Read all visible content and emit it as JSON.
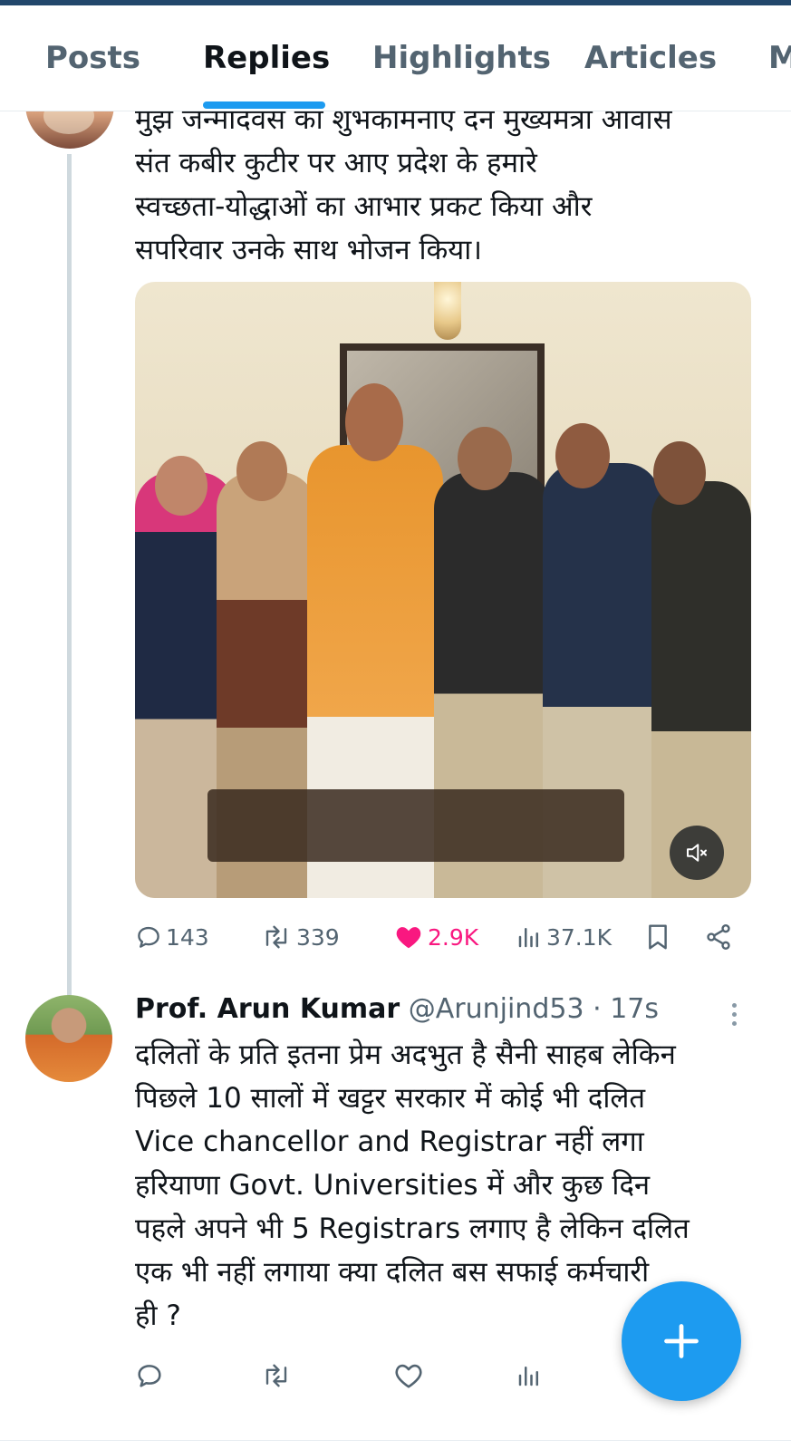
{
  "tabs": [
    {
      "label": "Posts"
    },
    {
      "label": "Replies"
    },
    {
      "label": "Highlights"
    },
    {
      "label": "Articles"
    }
  ],
  "active_tab": "Replies",
  "tweet": {
    "text_lines": [
      "मुझे जन्मदिवस की शुभकामनाएं देने मुख्यमंत्री आवास",
      "संत कबीर कुटीर पर आए प्रदेश के हमारे",
      "स्वच्छता-योद्धाओं का आभार प्रकट किया और",
      "सपरिवार उनके साथ भोजन किया।"
    ],
    "stats": {
      "replies": "143",
      "reposts": "339",
      "likes": "2.9K",
      "views": "37.1K"
    }
  },
  "reply": {
    "name": "Prof. Arun Kumar",
    "handle": "@Arunjind53",
    "separator": "·",
    "time": "17s",
    "text_lines": [
      "दलितों के प्रति इतना प्रेम अदभुत है सैनी साहब लेकिन",
      "पिछले 10 सालों में खट्टर सरकार में कोई भी दलित",
      "Vice chancellor and Registrar नहीं लगा",
      "हरियाणा Govt. Universities में और कुछ दिन",
      "पहले अपने भी 5 Registrars लगाए है लेकिन दलित",
      "एक भी नहीं लगाया क्या दलित बस सफाई कर्मचारी",
      "ही ?"
    ]
  },
  "colors": {
    "accent": "#1d9bf0",
    "like": "#f91880",
    "muted_text": "#536471",
    "header_strip": "#22476b"
  },
  "icons": [
    "reply-icon",
    "repost-icon",
    "like-icon",
    "views-icon",
    "bookmark-icon",
    "share-icon",
    "mute-icon",
    "more-icon",
    "compose-icon"
  ]
}
